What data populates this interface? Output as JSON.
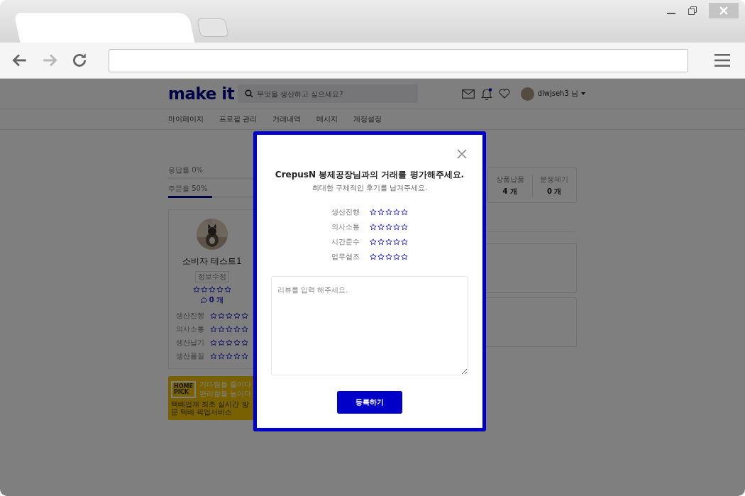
{
  "browser": {
    "tabs": [
      {
        "selected": true
      },
      {
        "selected": false
      }
    ],
    "nav": [
      {
        "kind": "back",
        "disabled": false
      },
      {
        "kind": "forward",
        "disabled": true
      },
      {
        "kind": "reload",
        "disabled": false
      }
    ]
  },
  "header": {
    "logo": "make it",
    "search_placeholder": "무엇을 생산하고 싶으세요?",
    "user": "dlwjseh3 님",
    "has_notification": true
  },
  "nav": [
    "마이페이지",
    "프로필 관리",
    "거래내역",
    "메시지",
    "계정설정"
  ],
  "rates": [
    {
      "label": "응답률 0%",
      "level": 0
    },
    {
      "label": "주문율 50%",
      "level": 0.5
    }
  ],
  "profile": {
    "name": "소비자 테스트1",
    "edit_button": "정보수정",
    "stars": 0,
    "review_count": "0 개",
    "ratings": [
      {
        "label": "생산진행",
        "stars": 0
      },
      {
        "label": "의사소통",
        "stars": 0
      },
      {
        "label": "생산납기",
        "stars": 0
      },
      {
        "label": "생산품질",
        "stars": 0
      }
    ]
  },
  "banner": {
    "logo_lines": [
      "HOME",
      "PICK"
    ],
    "headline": [
      "기다림을 줄이다",
      "편리함을 높이다"
    ],
    "caption": "택배업계 최초 실시간 방문 택배 픽업서비스"
  },
  "stats": [
    {
      "label": "상품납품",
      "value": "4 개"
    },
    {
      "label": "분쟁제기",
      "value": "0 개"
    }
  ],
  "modal": {
    "title": "CrepusN 봉제공장님과의 거래를 평가해주세요.",
    "subtitle": "최대한 구체적인 후기를 남겨주세요.",
    "ratings": [
      {
        "label": "생산진행",
        "stars": 0
      },
      {
        "label": "의사소통",
        "stars": 0
      },
      {
        "label": "시간준수",
        "stars": 0
      },
      {
        "label": "업무협조",
        "stars": 0
      }
    ],
    "review_placeholder": "리뷰를 입력 해주세요.",
    "submit": "등록하기"
  }
}
